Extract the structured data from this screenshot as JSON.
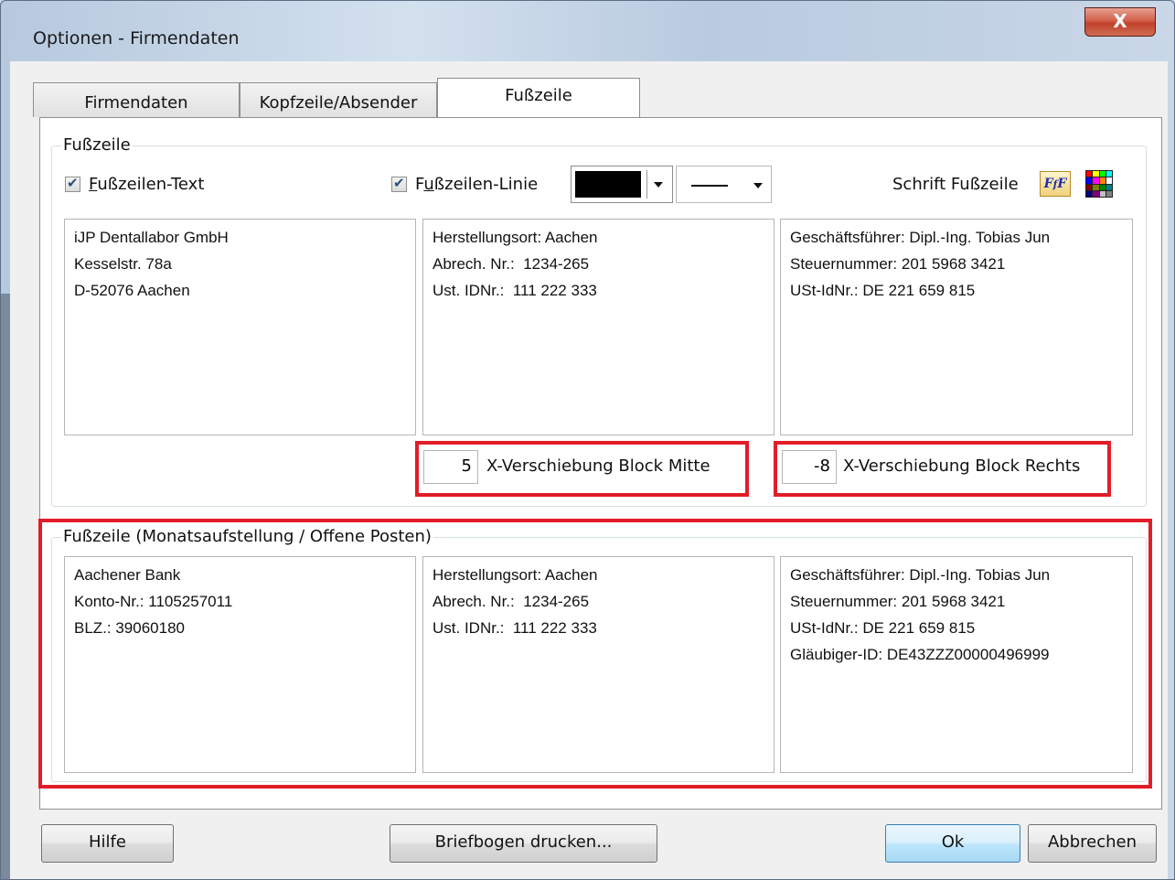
{
  "window": {
    "title": "Optionen - Firmendaten",
    "close_glyph": "X"
  },
  "tabs": [
    {
      "label": "Firmendaten",
      "active": false
    },
    {
      "label": "Kopfzeile/Absender",
      "active": false
    },
    {
      "label": "Fußzeile",
      "active": true
    }
  ],
  "footer_group": {
    "title": "Fußzeile",
    "text_checkbox": {
      "prefix": "",
      "accel": "F",
      "rest": "ußzeilen-Text",
      "checked": true
    },
    "line_checkbox": {
      "prefix": "F",
      "accel": "u",
      "rest": "ßzeilen-Linie",
      "checked": true
    },
    "line_color": "#000000",
    "line_style": "solid",
    "font_label": "Schrift Fußzeile",
    "block_left": "iJP Dentallabor GmbH\nKesselstr. 78a\nD-52076 Aachen",
    "block_middle": "Herstellungsort: Aachen\nAbrech. Nr.:  1234-265\nUst. IDNr.:  111 222 333",
    "block_right": "Geschäftsführer: Dipl.-Ing. Tobias Jun\nSteuernummer: 201 5968 3421\nUSt-IdNr.: DE 221 659 815",
    "offset_middle": {
      "value": "5",
      "label": "X-Verschiebung Block Mitte"
    },
    "offset_right": {
      "value": "-8",
      "label": "X-Verschiebung Block Rechts"
    }
  },
  "monthly_group": {
    "title": "Fußzeile (Monatsaufstellung / Offene Posten)",
    "block_left": "Aachener Bank\nKonto-Nr.: 1105257011\nBLZ.: 39060180",
    "block_middle": "Herstellungsort: Aachen\nAbrech. Nr.:  1234-265\nUst. IDNr.:  111 222 333",
    "block_right": "Geschäftsführer: Dipl.-Ing. Tobias Jun\nSteuernummer: 201 5968 3421\nUSt-IdNr.: DE 221 659 815\nGläubiger-ID: DE43ZZZ00000496999"
  },
  "buttons": {
    "help": "Hilfe",
    "print": "Briefbogen drucken...",
    "ok": "Ok",
    "cancel": "Abbrechen"
  },
  "colors": {
    "highlight": "#e11d28",
    "default_button": "#3c7fb1"
  }
}
